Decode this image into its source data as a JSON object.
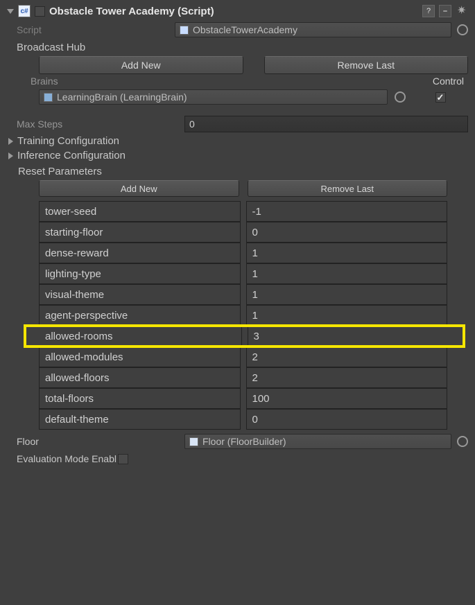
{
  "header": {
    "title": "Obstacle Tower Academy (Script)",
    "enabled": false
  },
  "script": {
    "label": "Script",
    "value": "ObstacleTowerAcademy"
  },
  "broadcastHub": {
    "label": "Broadcast Hub",
    "addNew": "Add New",
    "removeLast": "Remove Last",
    "brainsLabel": "Brains",
    "controlLabel": "Control",
    "brainValue": "LearningBrain (LearningBrain)",
    "controlChecked": true
  },
  "maxSteps": {
    "label": "Max Steps",
    "value": "0"
  },
  "trainingConfig": {
    "label": "Training Configuration"
  },
  "inferenceConfig": {
    "label": "Inference Configuration"
  },
  "resetParams": {
    "label": "Reset Parameters",
    "addNew": "Add New",
    "removeLast": "Remove Last",
    "rows": [
      {
        "key": "tower-seed",
        "val": "-1",
        "hl": false
      },
      {
        "key": "starting-floor",
        "val": "0",
        "hl": false
      },
      {
        "key": "dense-reward",
        "val": "1",
        "hl": false
      },
      {
        "key": "lighting-type",
        "val": "1",
        "hl": false
      },
      {
        "key": "visual-theme",
        "val": "1",
        "hl": false
      },
      {
        "key": "agent-perspective",
        "val": "1",
        "hl": false
      },
      {
        "key": "allowed-rooms",
        "val": "3",
        "hl": true
      },
      {
        "key": "allowed-modules",
        "val": "2",
        "hl": false
      },
      {
        "key": "allowed-floors",
        "val": "2",
        "hl": false
      },
      {
        "key": "total-floors",
        "val": "100",
        "hl": false
      },
      {
        "key": "default-theme",
        "val": "0",
        "hl": false
      }
    ]
  },
  "floor": {
    "label": "Floor",
    "value": "Floor (FloorBuilder)"
  },
  "evalMode": {
    "label": "Evaluation Mode Enabl",
    "checked": false
  }
}
